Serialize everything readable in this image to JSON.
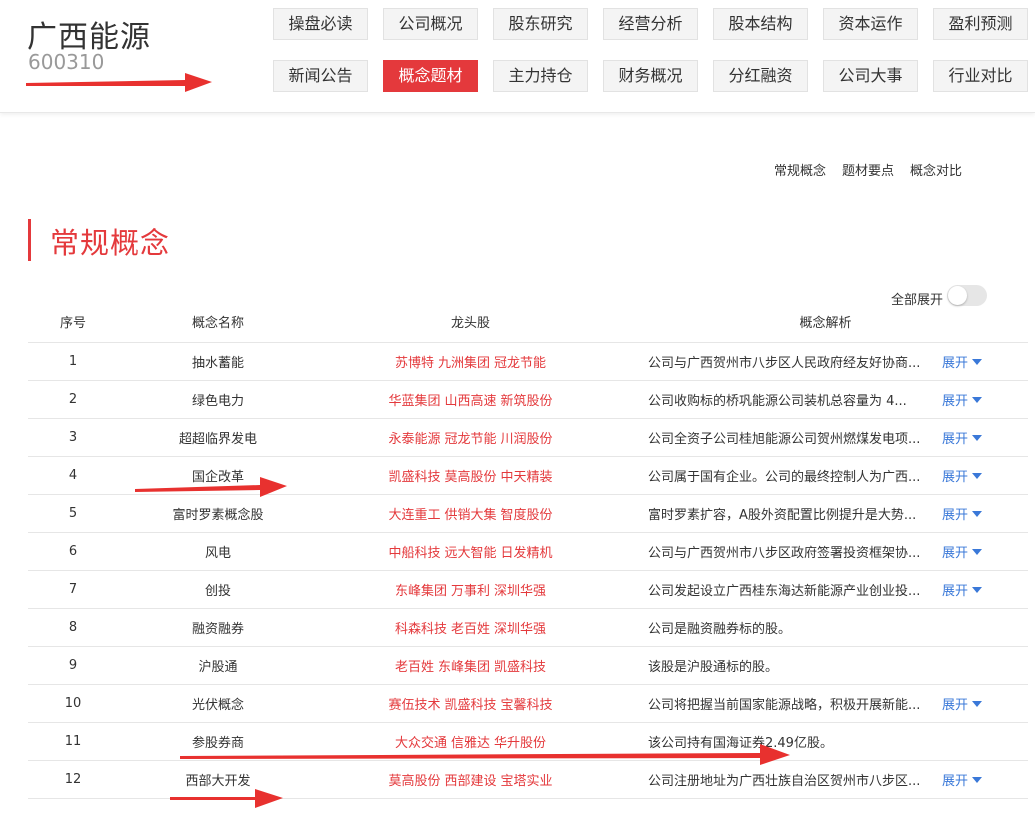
{
  "stock": {
    "name": "广西能源",
    "code": "600310"
  },
  "nav": {
    "row1": [
      "操盘必读",
      "公司概况",
      "股东研究",
      "经营分析",
      "股本结构",
      "资本运作",
      "盈利预测"
    ],
    "row2": [
      "新闻公告",
      "概念题材",
      "主力持仓",
      "财务概况",
      "分红融资",
      "公司大事",
      "行业对比"
    ],
    "active": "概念题材"
  },
  "sublinks": [
    "常规概念",
    "题材要点",
    "概念对比"
  ],
  "section_title": "常规概念",
  "toggle_label": "全部展开",
  "table": {
    "headers": {
      "idx": "序号",
      "name": "概念名称",
      "lead": "龙头股",
      "desc": "概念解析"
    },
    "expand_label": "展开",
    "rows": [
      {
        "idx": "1",
        "name": "抽水蓄能",
        "leads": [
          "苏博特",
          "九洲集团",
          "冠龙节能"
        ],
        "desc": "公司与广西贺州市八步区人民政府经友好协商...",
        "expand": true
      },
      {
        "idx": "2",
        "name": "绿色电力",
        "leads": [
          "华蓝集团",
          "山西高速",
          "新筑股份"
        ],
        "desc": "公司收购标的桥巩能源公司装机总容量为 4...",
        "expand": true
      },
      {
        "idx": "3",
        "name": "超超临界发电",
        "leads": [
          "永泰能源",
          "冠龙节能",
          "川润股份"
        ],
        "desc": "公司全资子公司桂旭能源公司贺州燃煤发电项...",
        "expand": true
      },
      {
        "idx": "4",
        "name": "国企改革",
        "leads": [
          "凯盛科技",
          "莫高股份",
          "中天精装"
        ],
        "desc": "公司属于国有企业。公司的最终控制人为广西...",
        "expand": true
      },
      {
        "idx": "5",
        "name": "富时罗素概念股",
        "leads": [
          "大连重工",
          "供销大集",
          "智度股份"
        ],
        "desc": "富时罗素扩容，A股外资配置比例提升是大势...",
        "expand": true
      },
      {
        "idx": "6",
        "name": "风电",
        "leads": [
          "中船科技",
          "远大智能",
          "日发精机"
        ],
        "desc": "公司与广西贺州市八步区政府签署投资框架协...",
        "expand": true
      },
      {
        "idx": "7",
        "name": "创投",
        "leads": [
          "东峰集团",
          "万事利",
          "深圳华强"
        ],
        "desc": "公司发起设立广西桂东海达新能源产业创业投...",
        "expand": true
      },
      {
        "idx": "8",
        "name": "融资融券",
        "leads": [
          "科森科技",
          "老百姓",
          "深圳华强"
        ],
        "desc": "公司是融资融券标的股。",
        "expand": false
      },
      {
        "idx": "9",
        "name": "沪股通",
        "leads": [
          "老百姓",
          "东峰集团",
          "凯盛科技"
        ],
        "desc": "该股是沪股通标的股。",
        "expand": false
      },
      {
        "idx": "10",
        "name": "光伏概念",
        "leads": [
          "赛伍技术",
          "凯盛科技",
          "宝馨科技"
        ],
        "desc": "公司将把握当前国家能源战略，积极开展新能...",
        "expand": true
      },
      {
        "idx": "11",
        "name": "参股券商",
        "leads": [
          "大众交通",
          "信雅达",
          "华升股份"
        ],
        "desc": "该公司持有国海证券2.49亿股。",
        "expand": false
      },
      {
        "idx": "12",
        "name": "西部大开发",
        "leads": [
          "莫高股份",
          "西部建设",
          "宝塔实业"
        ],
        "desc": "公司注册地址为广西壮族自治区贺州市八步区...",
        "expand": true
      }
    ]
  },
  "colors": {
    "accent": "#e4393c",
    "link_blue": "#3a78d8",
    "annotation_arrow": "#e8312f"
  }
}
